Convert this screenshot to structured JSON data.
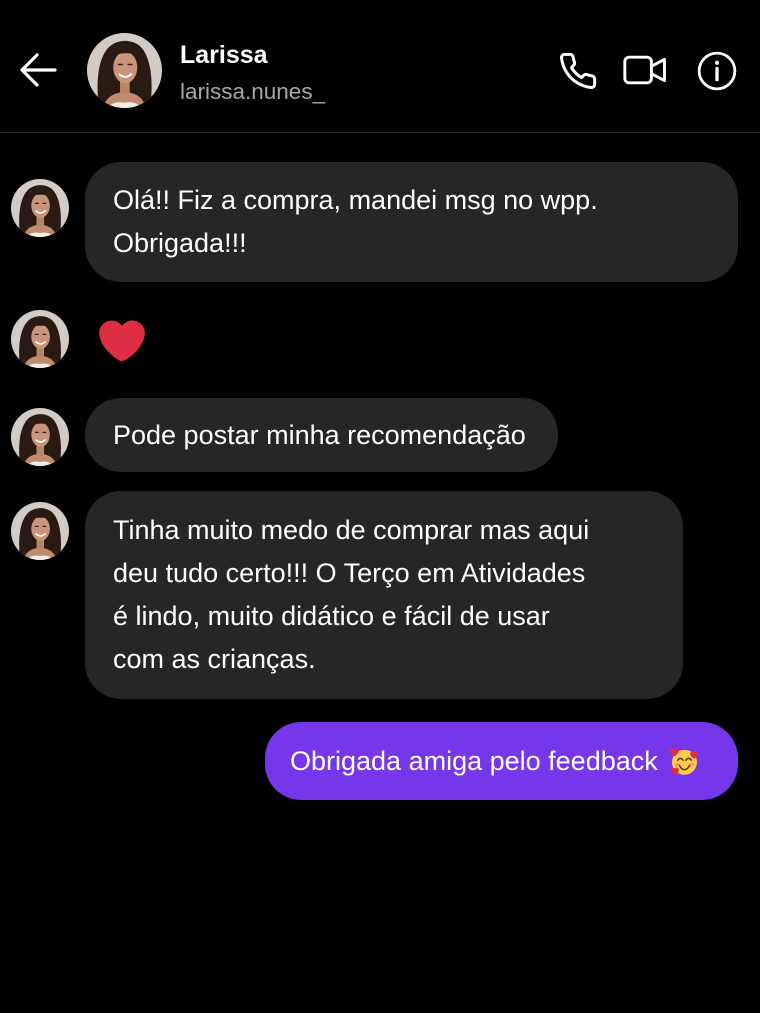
{
  "colors": {
    "background": "#000000",
    "text_primary": "#ffffff",
    "text_secondary": "#a8a8a8",
    "incoming_bubble": "#262626",
    "outgoing_bubble": "#7637ea",
    "divider": "#262626"
  },
  "header": {
    "name": "Larissa",
    "username": "larissa.nunes_",
    "icons": {
      "back": "back-arrow-icon",
      "call": "phone-icon",
      "video": "video-camera-icon",
      "info": "info-icon"
    }
  },
  "chat": {
    "incoming": [
      {
        "lines": [
          "Olá!! Fiz a compra, mandei msg no wpp.",
          "Obrigada!!!"
        ]
      },
      {
        "emoji_icon": "red-heart-icon"
      },
      {
        "lines": [
          "Pode postar minha recomendação"
        ]
      },
      {
        "lines": [
          "Tinha muito medo de comprar mas aqui",
          "deu tudo certo!!! O Terço em Atividades",
          "é lindo, muito didático e fácil de usar",
          "com as crianças."
        ]
      }
    ],
    "outgoing": [
      {
        "text": "Obrigada amiga pelo feedback",
        "emoji_icon": "smiling-face-with-hearts-icon"
      }
    ]
  }
}
